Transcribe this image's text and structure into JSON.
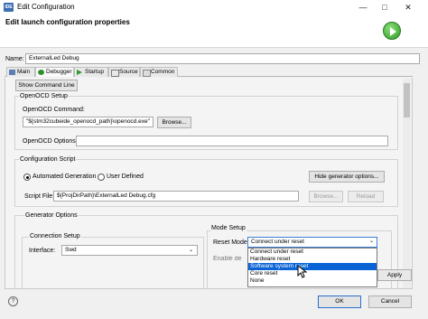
{
  "window": {
    "app_icon": "IDE",
    "title": "Edit Configuration",
    "minimize": "—",
    "maximize": "□",
    "close": "✕",
    "header_title": "Edit launch configuration properties"
  },
  "name": {
    "label": "Name:",
    "value": "ExternalLed Debug"
  },
  "tabs": [
    {
      "label": "Main",
      "icon": "main-tab-icon",
      "active": false
    },
    {
      "label": "Debugger",
      "icon": "debugger-tab-icon",
      "active": true
    },
    {
      "label": "Startup",
      "icon": "startup-tab-icon",
      "active": false
    },
    {
      "label": "Source",
      "icon": "source-tab-icon",
      "active": false
    },
    {
      "label": "Common",
      "icon": "common-tab-icon",
      "active": false
    }
  ],
  "debugger": {
    "show_command_line": "Show Command Line",
    "openocd_setup": {
      "title": "OpenOCD Setup",
      "command_label": "OpenOCD Command:",
      "command_value": "\"${stm32cubeide_openocd_path}\\openocd.exe\"",
      "browse": "Browse...",
      "options_label": "OpenOCD Options :",
      "options_value": ""
    },
    "config_script": {
      "title": "Configuration Script",
      "automated": "Automated Generation",
      "user_defined": "User Defined",
      "hide_options": "Hide generator options...",
      "script_file_label": "Script File:",
      "script_file_value": "${ProjDirPath}\\ExternalLed Debug.cfg",
      "browse": "Browse...",
      "reload": "Reload"
    },
    "generator_options": {
      "title": "Generator Options",
      "connection_setup": "Connection Setup",
      "interface_label": "Interface:",
      "interface_value": "Swd",
      "mode_setup": "Mode Setup",
      "reset_mode_label": "Reset Mode:",
      "reset_mode_value": "Connect under reset",
      "reset_options": [
        "Connect under reset",
        "Hardware reset",
        "Software system reset",
        "Core reset",
        "None"
      ],
      "highlighted_index": 2,
      "enable_partial": "Enable de"
    }
  },
  "footer": {
    "help": "?",
    "apply": "Apply",
    "ok": "OK",
    "cancel": "Cancel"
  }
}
